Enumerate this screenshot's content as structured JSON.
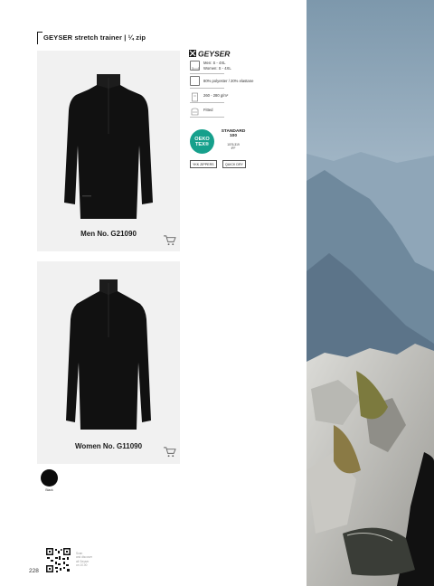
{
  "header": {
    "title": "GEYSER stretch trainer | ¼ zip"
  },
  "brand": {
    "logo_text": "GEYSER"
  },
  "specs": {
    "sizes": [
      "Men: S - 4XL",
      "Women: S - 4XL"
    ],
    "material": "80% polyester / 20% elastane",
    "weight": "260 - 280 g/m²",
    "fit": "Fitted"
  },
  "certification": {
    "badge_line1": "OEKO",
    "badge_line2": "TEX®",
    "standard_line1": "STANDARD",
    "standard_line2": "100",
    "code_line1": "1076-319",
    "code_line2": "IFF"
  },
  "features": [
    "YKK ZIPPERS",
    "QUICK DRY"
  ],
  "products": [
    {
      "name": "Men No. G21090"
    },
    {
      "name": "Women No. G11090"
    }
  ],
  "colors": [
    {
      "name": "Black",
      "hex": "#0b0b0b"
    }
  ],
  "qr_caption": [
    "Scan",
    "and discover",
    "all Geyser",
    "on 10.00"
  ],
  "page_number": "228"
}
